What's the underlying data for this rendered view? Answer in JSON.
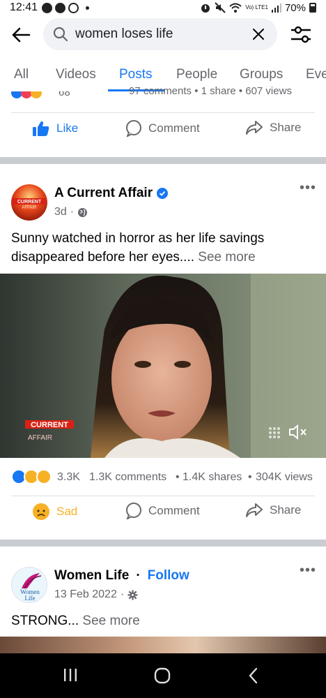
{
  "status_bar": {
    "time": "12:41",
    "carrier": "Vo) LTE1",
    "battery": "70%",
    "icons": [
      "messenger-icon",
      "facebook-icon",
      "circle-icon",
      "alarm-icon",
      "mute-icon",
      "wifi-icon",
      "signal-icon",
      "battery-icon"
    ]
  },
  "search": {
    "query": "women loses life",
    "back_icon": "back-arrow-icon",
    "search_icon": "search-icon",
    "clear_icon": "close-icon",
    "filter_icon": "filter-sliders-icon"
  },
  "tabs": [
    {
      "label": "All",
      "active": false
    },
    {
      "label": "Videos",
      "active": false
    },
    {
      "label": "Posts",
      "active": true
    },
    {
      "label": "People",
      "active": false
    },
    {
      "label": "Groups",
      "active": false
    },
    {
      "label": "Eve",
      "active": false
    }
  ],
  "previous_post": {
    "reaction_count": "68",
    "stats": "97 comments • 1 share • 607 views",
    "actions": {
      "like": "Like",
      "comment": "Comment",
      "share": "Share"
    }
  },
  "post1": {
    "author": "A Current Affair",
    "verified": true,
    "time": "3d",
    "privacy_icon": "globe-icon",
    "avatar_text": "CURRENT AFFAIR",
    "text": "Sunny watched in horror as her life savings disappeared before her eyes....",
    "see_more": "See more",
    "watermark": "CURRENT AFFAIR",
    "reaction_count": "3.3K",
    "comments": "1.3K comments",
    "shares": "1.4K shares",
    "views": "304K views",
    "actions": {
      "reaction": "Sad",
      "comment": "Comment",
      "share": "Share"
    }
  },
  "post2": {
    "author": "Women Life",
    "follow": "Follow",
    "date": "13 Feb 2022",
    "avatar_text": "Women Life",
    "privacy_icon": "settings-gear-icon",
    "text": "STRONG...",
    "see_more": "See more"
  },
  "colors": {
    "accent": "#1877f2",
    "muted": "#65676b",
    "sad": "#f7b125",
    "separator": "#c9ccd1"
  }
}
